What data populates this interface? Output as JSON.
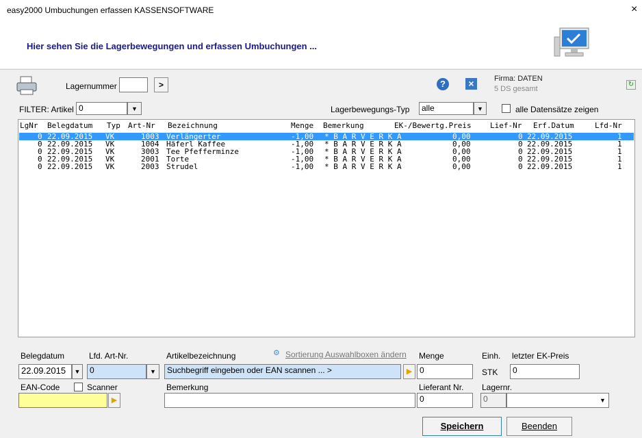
{
  "window": {
    "title": "easy2000 Umbuchungen erfassen KASSENSOFTWARE",
    "close_label": "×"
  },
  "header": {
    "subtitle": "Hier sehen Sie die Lagerbewegungen und erfassen Umbuchungen ..."
  },
  "toolbar": {
    "lagernummer_label": "Lagernummer",
    "lagernummer_value": "",
    "go_label": ">",
    "help_label": "?",
    "cancel_label": "×",
    "firma_label": "Firma: DATEN",
    "ds_count": "5 DS gesamt"
  },
  "filter": {
    "artikel_label": "FILTER: Artikel",
    "artikel_value": "0",
    "typ_label": "Lagerbewegungs-Typ",
    "typ_value": "alle",
    "all_records_label": "alle Datensätze zeigen"
  },
  "table": {
    "columns": [
      "LgNr",
      "Belegdatum",
      "Typ",
      "Art-Nr",
      "Bezeichnung",
      "Menge",
      "Bemerkung",
      "EK-/Bewertg.Preis",
      "Lief-Nr",
      "Erf.Datum",
      "Lfd-Nr"
    ],
    "rows": [
      [
        "0",
        "22.09.2015",
        "VK",
        "1003",
        "Verlängerter",
        "-1,00",
        "* B A R V E R K A",
        "0,00",
        "0",
        "22.09.2015",
        "1"
      ],
      [
        "0",
        "22.09.2015",
        "VK",
        "1004",
        "Häferl Kaffee",
        "-1,00",
        "* B A R V E R K A",
        "0,00",
        "0",
        "22.09.2015",
        "1"
      ],
      [
        "0",
        "22.09.2015",
        "VK",
        "3003",
        "Tee Pfefferminze",
        "-1,00",
        "* B A R V E R K A",
        "0,00",
        "0",
        "22.09.2015",
        "1"
      ],
      [
        "0",
        "22.09.2015",
        "VK",
        "2001",
        "Torte",
        "-1,00",
        "* B A R V E R K A",
        "0,00",
        "0",
        "22.09.2015",
        "1"
      ],
      [
        "0",
        "22.09.2015",
        "VK",
        "2003",
        "Strudel",
        "-1,00",
        "* B A R V E R K A",
        "0,00",
        "0",
        "22.09.2015",
        "1"
      ]
    ]
  },
  "form": {
    "belegdatum_label": "Belegdatum",
    "belegdatum_value": "22.09.2015",
    "lfd_label": "Lfd. Art-Nr.",
    "lfd_value": "0",
    "artikelbez_label": "Artikelbezeichnung",
    "sort_link": "Sortierung Auswahlboxen ändern",
    "artikel_search": "Suchbegriff eingeben oder EAN scannen ... >",
    "menge_label": "Menge",
    "menge_value": "0",
    "einh_label": "Einh.",
    "einh_value": "STK",
    "ek_label": "letzter EK-Preis",
    "ek_value": "0",
    "ean_label": "EAN-Code",
    "scanner_label": "Scanner",
    "ean_value": "",
    "bemerkung_label": "Bemerkung",
    "bemerkung_value": "",
    "lieferant_label": "Lieferant Nr.",
    "lieferant_value": "0",
    "lager_label": "Lagernr.",
    "lager_value": "0",
    "lager_select_value": ""
  },
  "buttons": {
    "save": "Speichern",
    "exit": "Beenden"
  },
  "colors": {
    "selection": "#3399ff",
    "heading": "#1a1a8c",
    "ean_bg": "#ffff99"
  }
}
